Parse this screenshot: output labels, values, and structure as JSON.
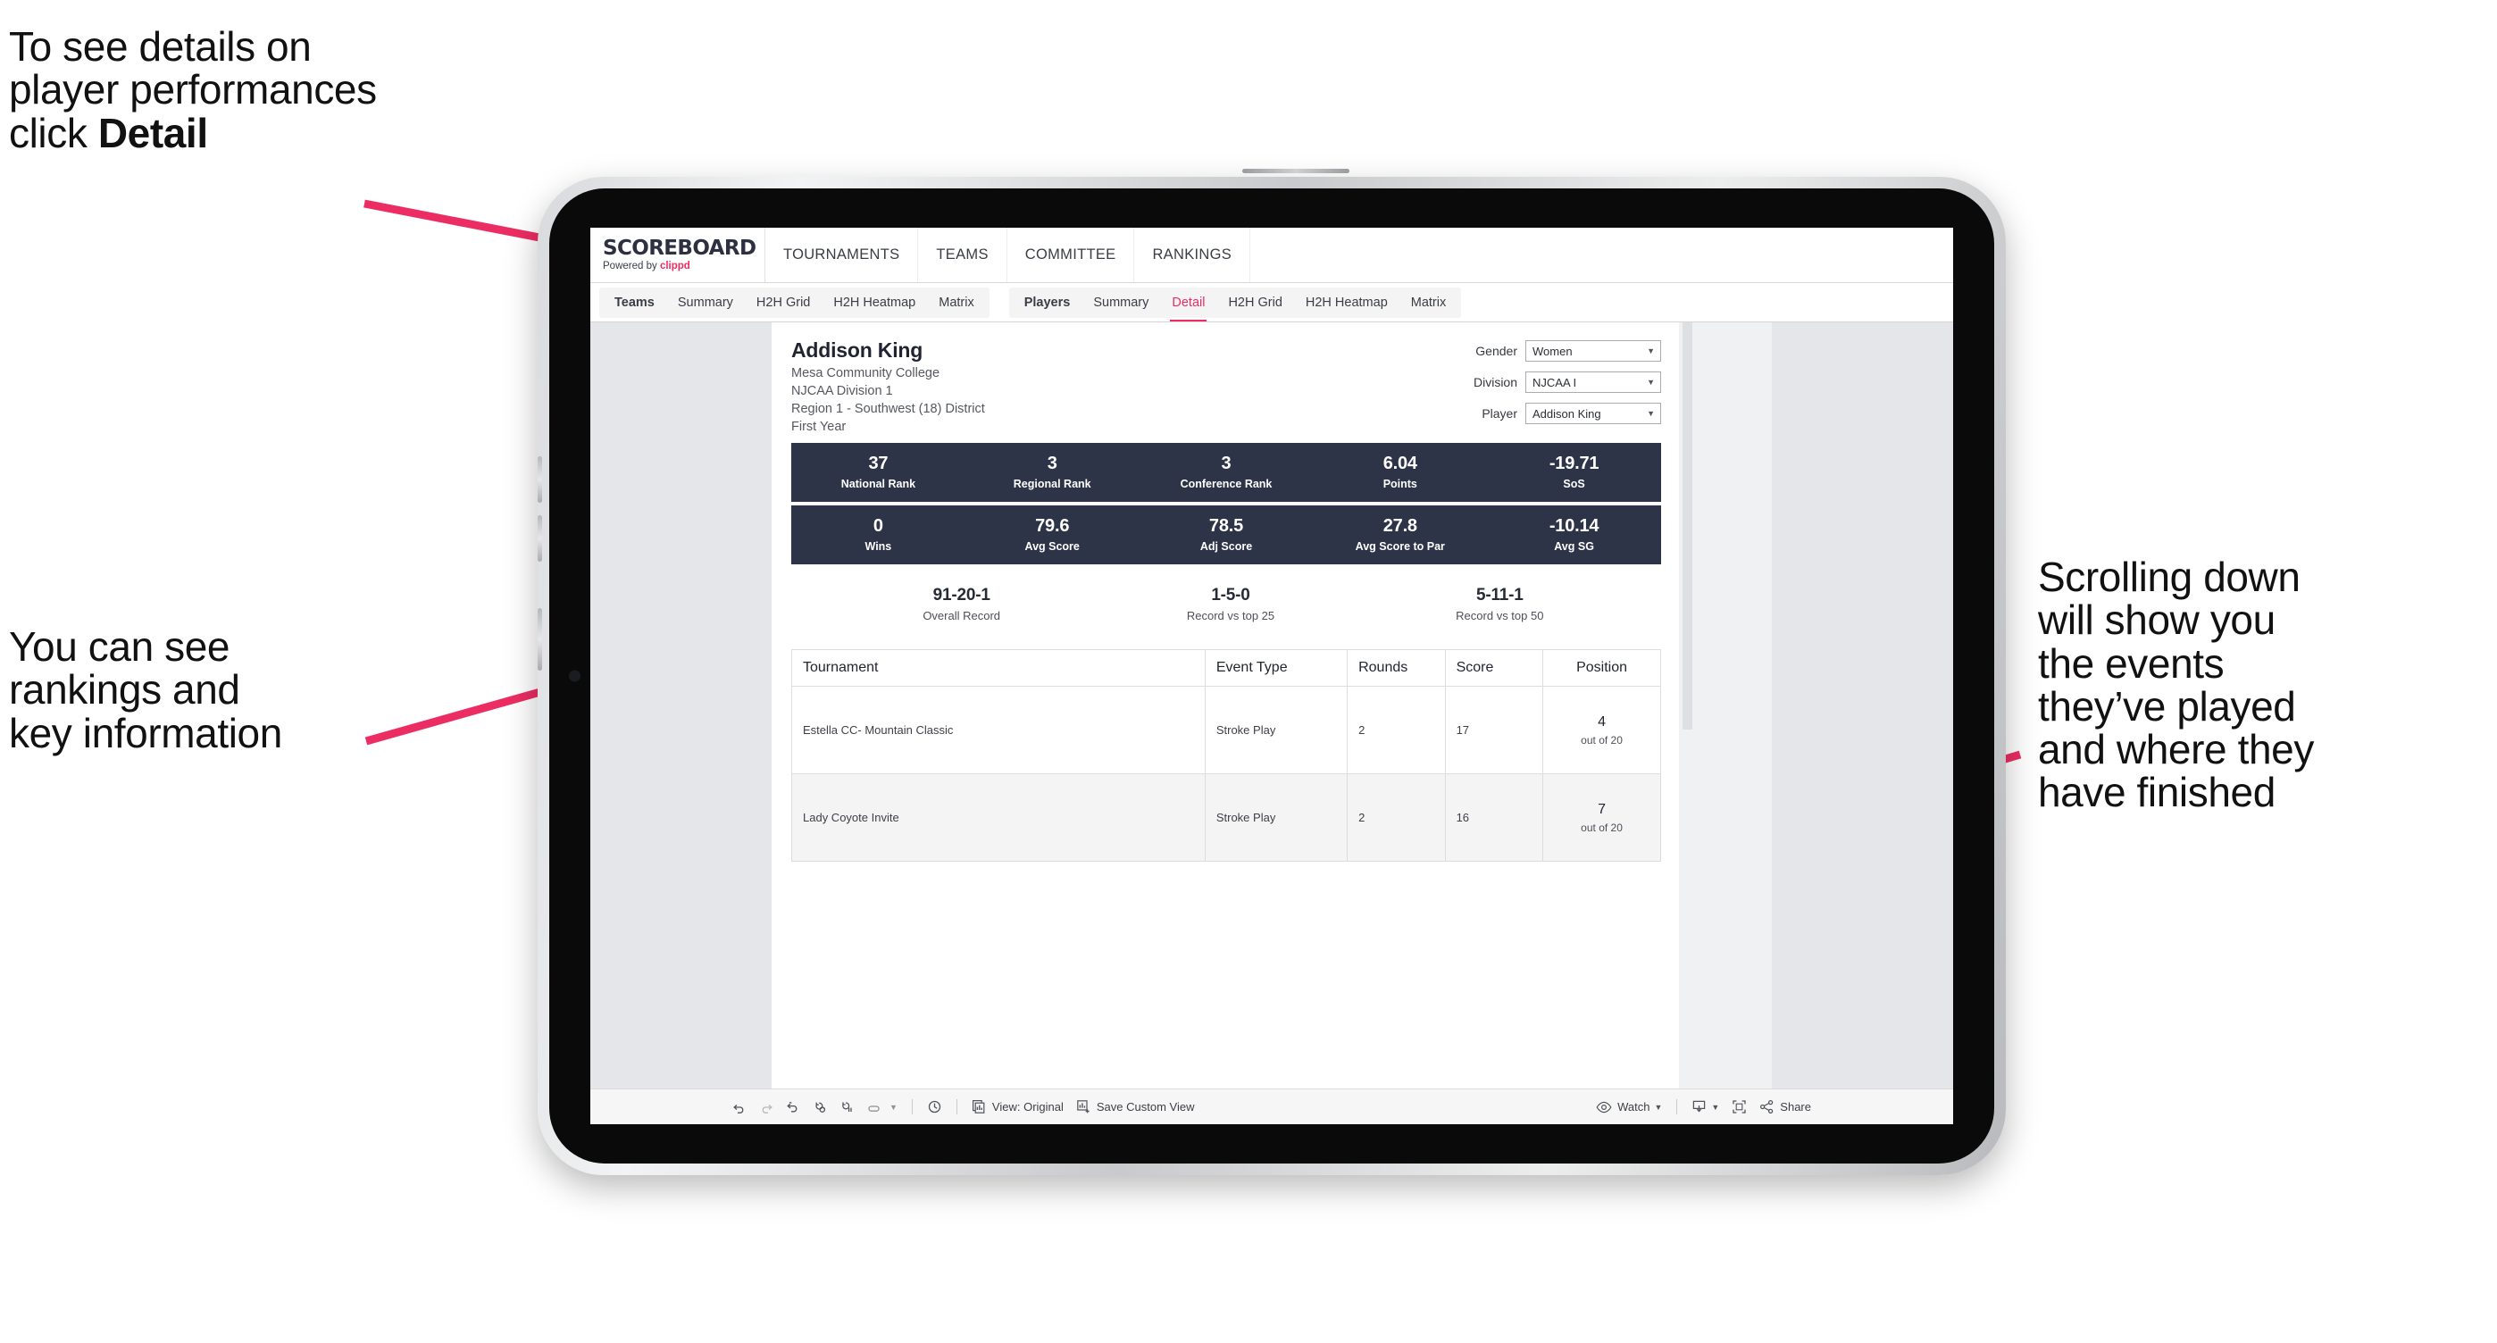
{
  "annotations": {
    "top_left": {
      "text_before": "To see details on\nplayer performances\nclick ",
      "bold": "Detail"
    },
    "left": {
      "text": "You can see\nrankings and\nkey information"
    },
    "right": {
      "text": "Scrolling down\nwill show you\nthe events\nthey’ve played\nand where they\nhave finished"
    }
  },
  "colors": {
    "accent_pink": "#ec2d63",
    "stat_bar_navy": "#2e3448",
    "app_bg": "#e4e6ea",
    "sheet_bg": "#f0f1f3"
  },
  "app": {
    "logo": {
      "word": "SCOREBOARD",
      "powered_by": "Powered by ",
      "brand": "clippd"
    },
    "top_nav": [
      {
        "label": "TOURNAMENTS"
      },
      {
        "label": "TEAMS"
      },
      {
        "label": "COMMITTEE"
      },
      {
        "label": "RANKINGS"
      }
    ],
    "tab_groups": [
      {
        "name": "teams-group",
        "tabs": [
          {
            "label": "Teams",
            "strong": true,
            "active": false
          },
          {
            "label": "Summary",
            "strong": false,
            "active": false
          },
          {
            "label": "H2H Grid",
            "strong": false,
            "active": false
          },
          {
            "label": "H2H Heatmap",
            "strong": false,
            "active": false
          },
          {
            "label": "Matrix",
            "strong": false,
            "active": false
          }
        ]
      },
      {
        "name": "players-group",
        "tabs": [
          {
            "label": "Players",
            "strong": true,
            "active": false
          },
          {
            "label": "Summary",
            "strong": false,
            "active": false
          },
          {
            "label": "Detail",
            "strong": false,
            "active": true
          },
          {
            "label": "H2H Grid",
            "strong": false,
            "active": false
          },
          {
            "label": "H2H Heatmap",
            "strong": false,
            "active": false
          },
          {
            "label": "Matrix",
            "strong": false,
            "active": false
          }
        ]
      }
    ],
    "player": {
      "name": "Addison King",
      "school": "Mesa Community College",
      "division": "NJCAA Division 1",
      "region": "Region 1 - Southwest (18) District",
      "class_year": "First Year"
    },
    "filters": [
      {
        "label": "Gender",
        "value": "Women"
      },
      {
        "label": "Division",
        "value": "NJCAA I"
      },
      {
        "label": "Player",
        "value": "Addison King"
      }
    ],
    "stat_rows": [
      [
        {
          "value": "37",
          "label": "National Rank"
        },
        {
          "value": "3",
          "label": "Regional Rank"
        },
        {
          "value": "3",
          "label": "Conference Rank"
        },
        {
          "value": "6.04",
          "label": "Points"
        },
        {
          "value": "-19.71",
          "label": "SoS"
        }
      ],
      [
        {
          "value": "0",
          "label": "Wins"
        },
        {
          "value": "79.6",
          "label": "Avg Score"
        },
        {
          "value": "78.5",
          "label": "Adj Score"
        },
        {
          "value": "27.8",
          "label": "Avg Score to Par"
        },
        {
          "value": "-10.14",
          "label": "Avg SG"
        }
      ]
    ],
    "records": [
      {
        "value": "91-20-1",
        "label": "Overall Record"
      },
      {
        "value": "1-5-0",
        "label": "Record vs top 25"
      },
      {
        "value": "5-11-1",
        "label": "Record vs top 50"
      }
    ],
    "events_table": {
      "columns": [
        "Tournament",
        "Event Type",
        "Rounds",
        "Score",
        "Position"
      ],
      "rows": [
        {
          "tournament": "Estella CC- Mountain Classic",
          "event_type": "Stroke Play",
          "rounds": "2",
          "score": "17",
          "position": "4",
          "position_out_of": "out of 20"
        },
        {
          "tournament": "Lady Coyote Invite",
          "event_type": "Stroke Play",
          "rounds": "2",
          "score": "16",
          "position": "7",
          "position_out_of": "out of 20"
        }
      ]
    },
    "toolbar": {
      "view_label": "View: Original",
      "save_label": "Save Custom View",
      "watch_label": "Watch",
      "share_label": "Share"
    }
  }
}
